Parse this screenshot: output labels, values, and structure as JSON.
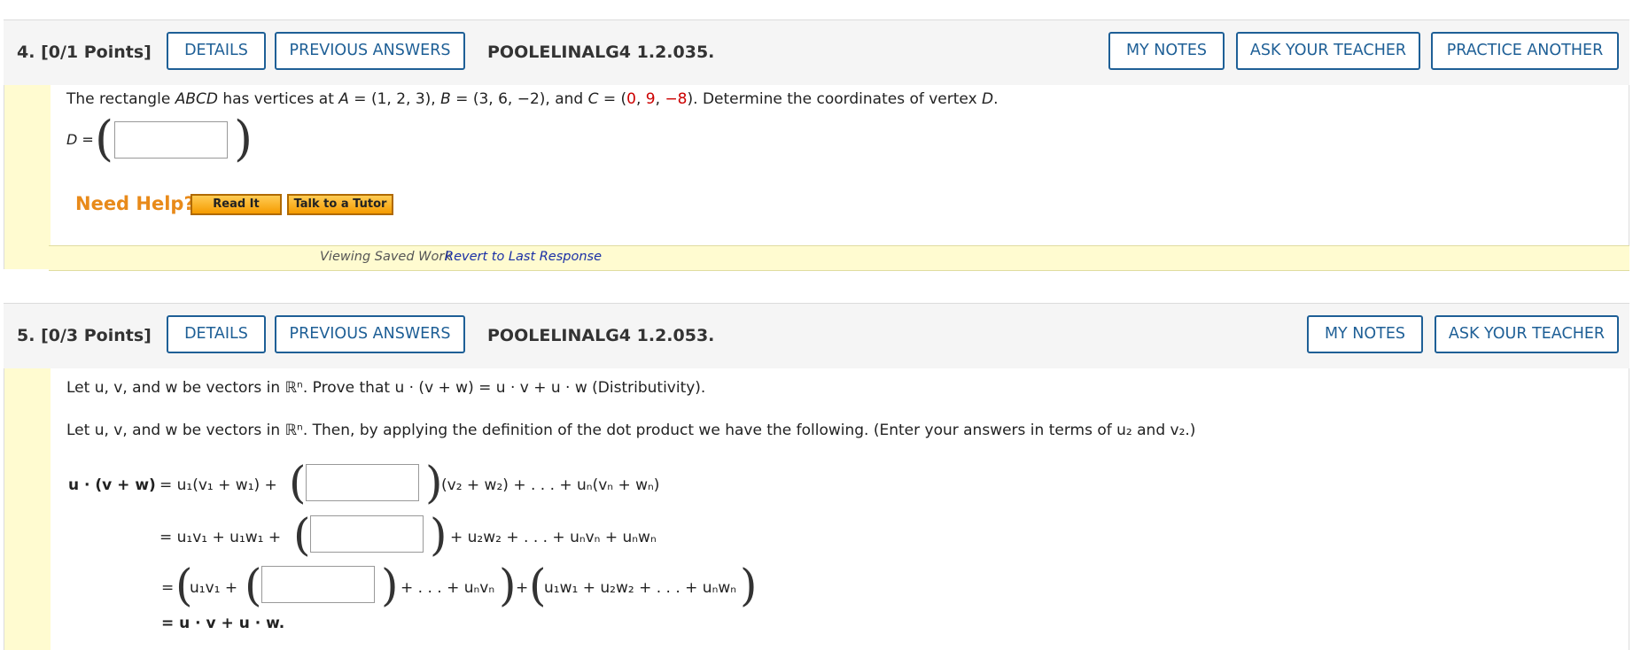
{
  "q4": {
    "number": "4.",
    "points": "[0/1 Points]",
    "details": "DETAILS",
    "previous_answers": "PREVIOUS ANSWERS",
    "code": "POOLELINALG4 1.2.035.",
    "my_notes": "MY NOTES",
    "ask_teacher": "ASK YOUR TEACHER",
    "practice": "PRACTICE ANOTHER",
    "q_text_pre": "The rectangle ",
    "rect": "ABCD",
    "q_text_mid": " has vertices at ",
    "A": "A",
    "A_val": " = (1, 2, 3), ",
    "B": "B",
    "B_val": " = (3, 6, −2), and ",
    "C": "C",
    "C_eq": " = (",
    "c1": "0",
    "c2": "9",
    "c3": "−8",
    "q_text_end": "). Determine the coordinates of vertex ",
    "D": "D",
    "period": ".",
    "answer_label": "D =",
    "need_help": "Need Help?",
    "read_it": "Read It",
    "talk_tutor": "Talk to a Tutor",
    "viewing_saved": "Viewing Saved Work",
    "revert": "Revert to Last Response"
  },
  "q5": {
    "number": "5.",
    "points": "[0/3 Points]",
    "details": "DETAILS",
    "previous_answers": "PREVIOUS ANSWERS",
    "code": "POOLELINALG4 1.2.053.",
    "my_notes": "MY NOTES",
    "ask_teacher": "ASK YOUR TEACHER",
    "line1": "Let u, v, and w be vectors in ℝⁿ. Prove that u · (v + w) = u · v + u · w (Distributivity).",
    "line2": "Let u, v, and w be vectors in ℝⁿ. Then, by applying the definition of the dot product we have the following. (Enter your answers in terms of u₂ and v₂.)",
    "row1_lhs": "u · (v + w)",
    "row1_a": "=  u₁(v₁ + w₁) +",
    "row1_b": "(v₂ + w₂) + . . . + uₙ(vₙ + wₙ)",
    "row2_a": "=  u₁v₁ + u₁w₁ +",
    "row2_b": "+ u₂w₂ + . . . + uₙvₙ + uₙwₙ",
    "row3_a": "=",
    "row3_b": "u₁v₁ +",
    "row3_c": "+ . . . + uₙvₙ",
    "row3_d": "+",
    "row3_e": "u₁w₁ + u₂w₂ + . . . + uₙwₙ",
    "row4": "=  u · v + u · w."
  }
}
